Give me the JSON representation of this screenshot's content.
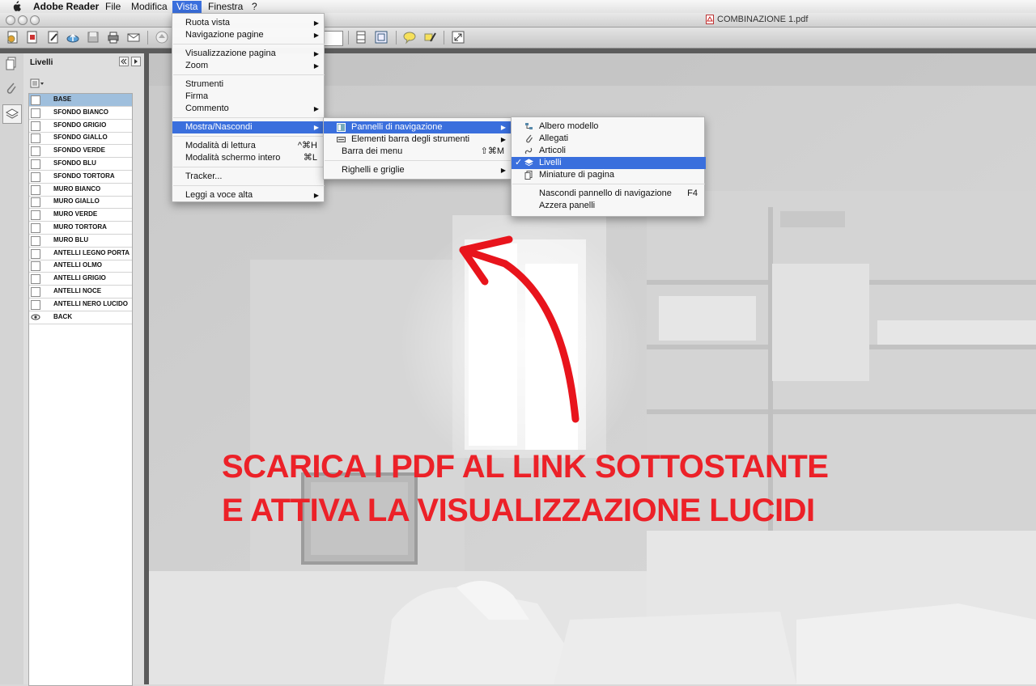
{
  "menubar": {
    "app": "Adobe Reader",
    "items": [
      "File",
      "Modifica",
      "Vista",
      "Finestra",
      "?"
    ],
    "active": "Vista"
  },
  "window": {
    "title": "COMBINAZIONE 1.pdf"
  },
  "panel": {
    "title": "Livelli",
    "layers": [
      {
        "label": "BASE",
        "selected": true
      },
      {
        "label": "SFONDO BIANCO"
      },
      {
        "label": "SFONDO GRIGIO"
      },
      {
        "label": "SFONDO GIALLO"
      },
      {
        "label": "SFONDO VERDE"
      },
      {
        "label": "SFONDO BLU"
      },
      {
        "label": "SFONDO TORTORA"
      },
      {
        "label": "MURO BIANCO"
      },
      {
        "label": "MURO GIALLO"
      },
      {
        "label": "MURO VERDE"
      },
      {
        "label": "MURO TORTORA"
      },
      {
        "label": "MURO BLU"
      },
      {
        "label": "ANTELLI LEGNO PORTA"
      },
      {
        "label": "ANTELLI OLMO"
      },
      {
        "label": "ANTELLI GRIGIO"
      },
      {
        "label": "ANTELLI NOCE"
      },
      {
        "label": "ANTELLI NERO LUCIDO"
      },
      {
        "label": "BACK",
        "visible": true
      }
    ]
  },
  "vista_menu": {
    "items": [
      {
        "label": "Ruota vista",
        "submenu": true
      },
      {
        "label": "Navigazione pagine",
        "submenu": true
      },
      {
        "sep": true
      },
      {
        "label": "Visualizzazione pagina",
        "submenu": true
      },
      {
        "label": "Zoom",
        "submenu": true
      },
      {
        "sep": true
      },
      {
        "label": "Strumenti"
      },
      {
        "label": "Firma"
      },
      {
        "label": "Commento",
        "submenu": true
      },
      {
        "sep": true
      },
      {
        "label": "Mostra/Nascondi",
        "submenu": true,
        "highlighted": true
      },
      {
        "sep": true
      },
      {
        "label": "Modalità di lettura",
        "shortcut": "^⌘H"
      },
      {
        "label": "Modalità schermo intero",
        "shortcut": "⌘L"
      },
      {
        "sep": true
      },
      {
        "label": "Tracker..."
      },
      {
        "sep": true
      },
      {
        "label": "Leggi a voce alta",
        "submenu": true
      }
    ]
  },
  "mostra_menu": {
    "items": [
      {
        "label": "Pannelli di navigazione",
        "submenu": true,
        "highlighted": true,
        "icon": "navigation-panels-icon"
      },
      {
        "label": "Elementi barra degli strumenti",
        "submenu": true,
        "icon": "toolbar-items-icon"
      },
      {
        "label": "Barra dei menu",
        "shortcut": "⇧⌘M"
      },
      {
        "sep": true
      },
      {
        "label": "Righelli e griglie",
        "submenu": true
      }
    ]
  },
  "pannelli_menu": {
    "items": [
      {
        "label": "Albero modello",
        "icon": "model-tree-icon"
      },
      {
        "label": "Allegati",
        "icon": "attachment-icon"
      },
      {
        "label": "Articoli",
        "icon": "articles-icon"
      },
      {
        "label": "Livelli",
        "icon": "layers-icon",
        "checked": true,
        "highlighted": true
      },
      {
        "label": "Miniature di pagina",
        "icon": "page-thumbnails-icon"
      },
      {
        "sep": true
      },
      {
        "label": "Nascondi pannello di navigazione",
        "shortcut": "F4"
      },
      {
        "label": "Azzera panelli"
      }
    ]
  },
  "overlay": {
    "line1": "SCARICA I PDF AL LINK SOTTOSTANTE",
    "line2": "E ATTIVA LA VISUALIZZAZIONE LUCIDI",
    "color": "#ec2128"
  },
  "colors": {
    "menu_highlight": "#3a6fdd",
    "layer_selected": "#9fbfdd"
  }
}
